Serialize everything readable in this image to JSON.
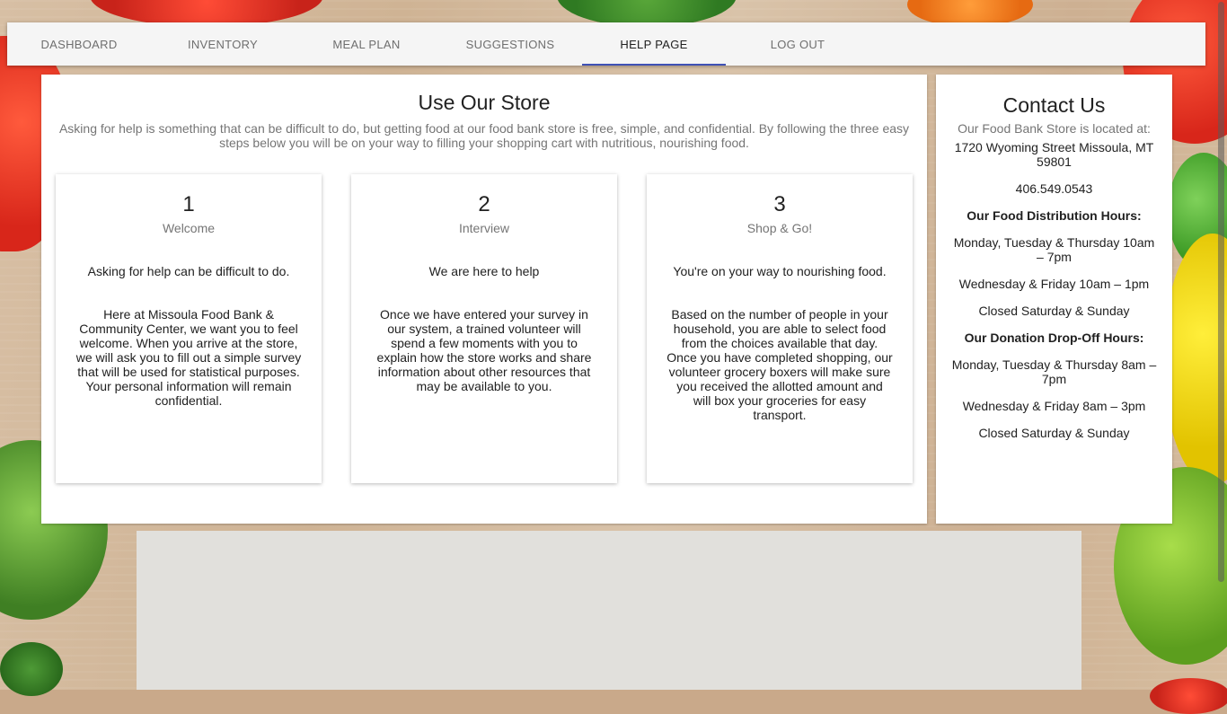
{
  "nav": {
    "items": [
      {
        "label": "DASHBOARD",
        "active": false
      },
      {
        "label": "INVENTORY",
        "active": false
      },
      {
        "label": "MEAL PLAN",
        "active": false
      },
      {
        "label": "SUGGESTIONS",
        "active": false
      },
      {
        "label": "HELP PAGE",
        "active": true
      },
      {
        "label": "LOG OUT",
        "active": false
      }
    ],
    "accent": "#3f51b5"
  },
  "main": {
    "title": "Use Our Store",
    "subtitle": "Asking for help is something that can be difficult to do, but getting food at our food bank store is free, simple, and confidential. By following the three easy steps below you will be on your way to filling your shopping cart with nutritious, nourishing food.",
    "steps": [
      {
        "number": "1",
        "name": "Welcome",
        "lead": "Asking for help can be difficult to do.",
        "body": "Here at Missoula Food Bank & Community Center, we want you to feel welcome. When you arrive at the store, we will ask you to fill out a simple survey that will be used for statistical purposes. Your personal information will remain confidential."
      },
      {
        "number": "2",
        "name": "Interview",
        "lead": "We are here to help",
        "body": "Once we have entered your survey in our system, a trained volunteer will spend a few moments with you to explain how the store works and share information about other resources that may be available to you."
      },
      {
        "number": "3",
        "name": "Shop & Go!",
        "lead": "You're on your way to nourishing food.",
        "body": "Based on the number of people in your household, you are able to select food from the choices available that day. Once you have completed shopping, our volunteer grocery boxers will make sure you received the allotted amount and will box your groceries for easy transport."
      }
    ]
  },
  "contact": {
    "title": "Contact Us",
    "located_label": "Our Food Bank Store is located at:",
    "address": "1720 Wyoming Street Missoula, MT 59801",
    "phone": "406.549.0543",
    "distribution_heading": "Our Food Distribution Hours:",
    "distribution_hours": [
      "Monday, Tuesday & Thursday 10am – 7pm",
      "Wednesday & Friday 10am – 1pm",
      "Closed Saturday & Sunday"
    ],
    "donation_heading": "Our Donation Drop-Off Hours:",
    "donation_hours": [
      "Monday, Tuesday & Thursday 8am – 7pm",
      "Wednesday & Friday 8am – 3pm",
      "Closed Saturday & Sunday"
    ]
  }
}
